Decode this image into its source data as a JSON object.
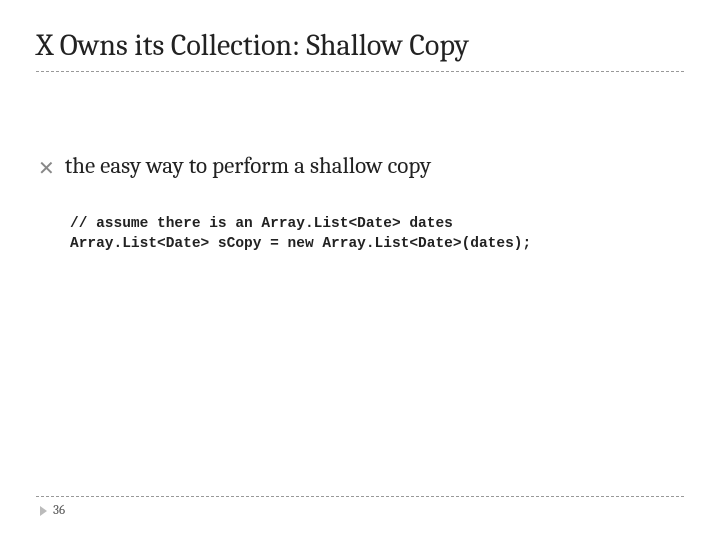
{
  "title": "X Owns its Collection: Shallow Copy",
  "bullet": {
    "marker": "✕",
    "text": "the easy way to perform a shallow copy"
  },
  "code": {
    "line1": "// assume there is an Array.List<Date> dates",
    "line2": "Array.List<Date> sCopy = new Array.List<Date>(dates);"
  },
  "page_number": "36"
}
